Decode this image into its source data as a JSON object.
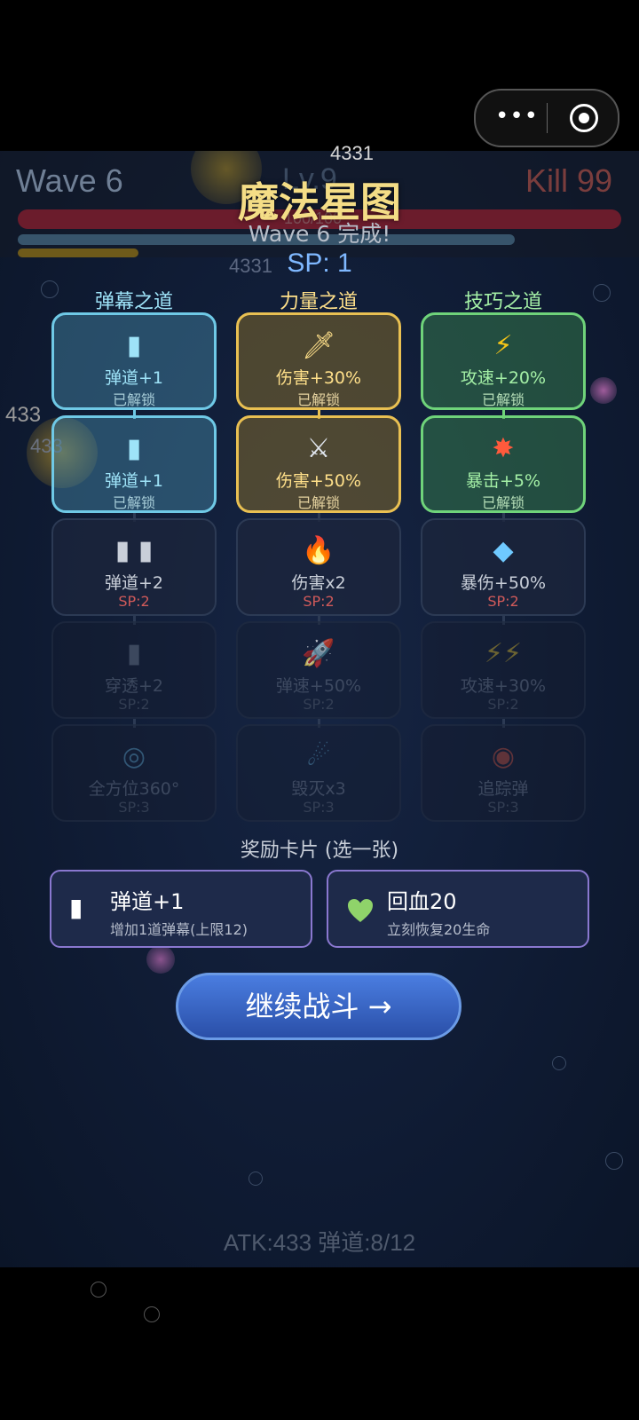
{
  "hud": {
    "wave": "Wave 6",
    "kill": "Kill 99",
    "level": "Lv.9",
    "hp": "100/100"
  },
  "floating_numbers": [
    "4331",
    "4331",
    "433",
    "433"
  ],
  "title": "魔法星图",
  "subtitle": "Wave 6 完成!",
  "sp": "SP: 1",
  "columns": [
    {
      "name": "弹幕之道",
      "color": "#9ee3f8"
    },
    {
      "name": "力量之道",
      "color": "#ffe08a"
    },
    {
      "name": "技巧之道",
      "color": "#a4f0a6"
    }
  ],
  "skills": {
    "r0": [
      {
        "icon": "▮",
        "name": "弹道+1",
        "status": "已解锁"
      },
      {
        "icon": "🗡",
        "name": "伤害+30%",
        "status": "已解锁"
      },
      {
        "icon": "⚡",
        "name": "攻速+20%",
        "status": "已解锁"
      }
    ],
    "r1": [
      {
        "icon": "▮",
        "name": "弹道+1",
        "status": "已解锁"
      },
      {
        "icon": "⚔",
        "name": "伤害+50%",
        "status": "已解锁"
      },
      {
        "icon": "✸",
        "name": "暴击+5%",
        "status": "已解锁"
      }
    ],
    "r2": [
      {
        "icon": "▮ ▮",
        "name": "弹道+2",
        "status": "SP:2"
      },
      {
        "icon": "🔥",
        "name": "伤害x2",
        "status": "SP:2"
      },
      {
        "icon": "◆",
        "name": "暴伤+50%",
        "status": "SP:2"
      }
    ],
    "r3": [
      {
        "icon": "▮",
        "name": "穿透+2",
        "status": "SP:2"
      },
      {
        "icon": "🚀",
        "name": "弹速+50%",
        "status": "SP:2"
      },
      {
        "icon": "⚡⚡",
        "name": "攻速+30%",
        "status": "SP:2"
      }
    ],
    "r4": [
      {
        "icon": "◎",
        "name": "全方位360°",
        "status": "SP:3"
      },
      {
        "icon": "☄",
        "name": "毁灭x3",
        "status": "SP:3"
      },
      {
        "icon": "◉",
        "name": "追踪弹",
        "status": "SP:3"
      }
    ]
  },
  "reward_title": "奖励卡片 (选一张)",
  "rewards": [
    {
      "icon": "▮",
      "title": "弹道+1",
      "desc": "增加1道弹幕(上限12)"
    },
    {
      "icon": "heart",
      "title": "回血20",
      "desc": "立刻恢复20生命"
    }
  ],
  "continue_label": "继续战斗 →",
  "footer": "ATK:433  弹道:8/12",
  "colors": {
    "accent": "#f4dd86",
    "blue": "#6fc9e6",
    "gold": "#e9c052",
    "green": "#6fd37a",
    "button": "#3a66c8"
  }
}
